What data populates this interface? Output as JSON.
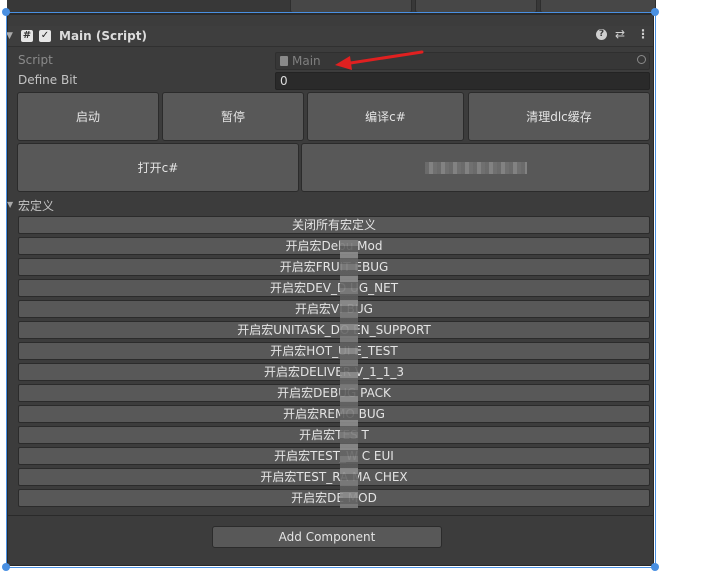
{
  "component": {
    "title": "Main (Script)",
    "enabled_mark": "✓",
    "header_icons": [
      "help-icon",
      "preset-icon",
      "menu-icon"
    ]
  },
  "fields": {
    "script_label": "Script",
    "script_value": "Main",
    "define_bit_label": "Define Bit",
    "define_bit_value": "0"
  },
  "buttons": {
    "start": "启动",
    "pause": "暂停",
    "compile": "编译c#",
    "clear_dlc": "清理dlc缓存",
    "open_cs": "打开c#"
  },
  "macros": {
    "section_label": "宏定义",
    "items": [
      "关闭所有宏定义",
      "开启宏Debu Mod",
      "开启宏FRUIT EBUG",
      "开启宏DEV_D UG_NET",
      "开启宏VI BUG",
      "开启宏UNITASK_DO EN_SUPPORT",
      "开启宏HOT_UI E_TEST",
      "开启宏DELIVER V_1_1_3",
      "开启宏DEBUG PACK",
      "开启宏REMO BUG",
      "开启宏TES T",
      "开启宏TEST_W C EUI",
      "开启宏TEST_RA MA CHEX",
      "开启宏DE MOD"
    ]
  },
  "footer": {
    "add_component": "Add Component"
  },
  "colors": {
    "panel_bg": "#3c3c3c",
    "button_bg": "#585858",
    "selection_outline": "#4a90e2",
    "annotation_arrow": "#e02020"
  }
}
